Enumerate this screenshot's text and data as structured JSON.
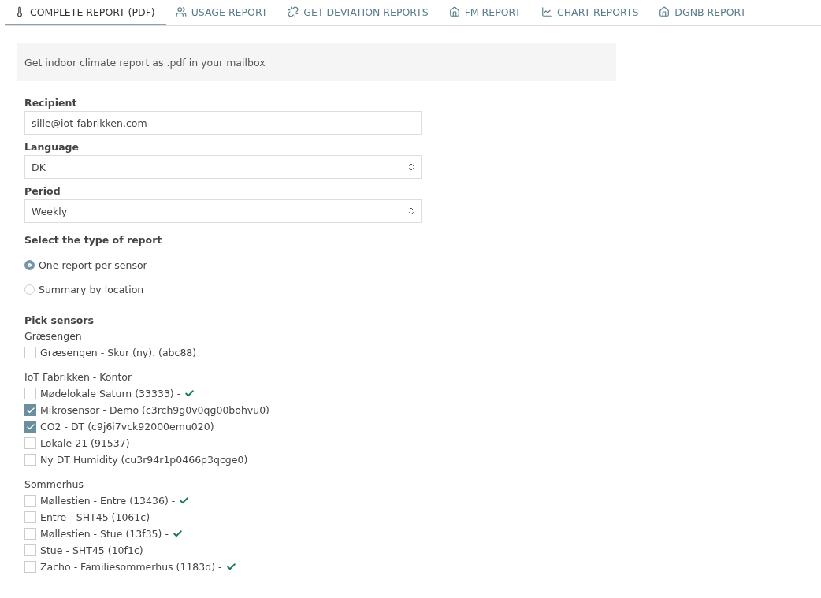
{
  "tabs": [
    {
      "label": "COMPLETE REPORT (PDF)",
      "kind": "thermometer",
      "selected": true
    },
    {
      "label": "USAGE REPORT",
      "kind": "users",
      "selected": false
    },
    {
      "label": "GET DEVIATION REPORTS",
      "kind": "unlink",
      "selected": false
    },
    {
      "label": "FM REPORT",
      "kind": "home",
      "selected": false
    },
    {
      "label": "CHART REPORTS",
      "kind": "chart",
      "selected": false
    },
    {
      "label": "DGNB REPORT",
      "kind": "house",
      "selected": false
    }
  ],
  "info": "Get indoor climate report as .pdf in your mailbox",
  "recipient": {
    "label": "Recipient",
    "value": "sille@iot-fabrikken.com"
  },
  "language": {
    "label": "Language",
    "value": "DK"
  },
  "period": {
    "label": "Period",
    "value": "Weekly"
  },
  "report_type": {
    "label": "Select the type of report",
    "options": [
      {
        "label": "One report per sensor",
        "selected": true
      },
      {
        "label": "Summary by location",
        "selected": false
      }
    ]
  },
  "sensors": {
    "label": "Pick sensors",
    "groups": [
      {
        "name": "Græsengen",
        "items": [
          {
            "label": "Græsengen - Skur (ny). (abc88)",
            "checked": false,
            "verified": false
          }
        ]
      },
      {
        "name": "IoT Fabrikken - Kontor",
        "items": [
          {
            "label": "Mødelokale Saturn (33333) -",
            "checked": false,
            "verified": true
          },
          {
            "label": "Mikrosensor - Demo (c3rch9g0v0qg00bohvu0)",
            "checked": true,
            "verified": false
          },
          {
            "label": "CO2 - DT (c9j6i7vck92000emu020)",
            "checked": true,
            "verified": false
          },
          {
            "label": "Lokale 21 (91537)",
            "checked": false,
            "verified": false
          },
          {
            "label": "Ny DT Humidity (cu3r94r1p0466p3qcge0)",
            "checked": false,
            "verified": false
          }
        ]
      },
      {
        "name": "Sommerhus",
        "items": [
          {
            "label": "Møllestien - Entre (13436) -",
            "checked": false,
            "verified": true
          },
          {
            "label": "Entre - SHT45 (1061c)",
            "checked": false,
            "verified": false
          },
          {
            "label": "Møllestien - Stue (13f35) -",
            "checked": false,
            "verified": true
          },
          {
            "label": "Stue - SHT45 (10f1c)",
            "checked": false,
            "verified": false
          },
          {
            "label": "Zacho - Familiesommerhus (1183d) -",
            "checked": false,
            "verified": true
          }
        ]
      }
    ]
  }
}
